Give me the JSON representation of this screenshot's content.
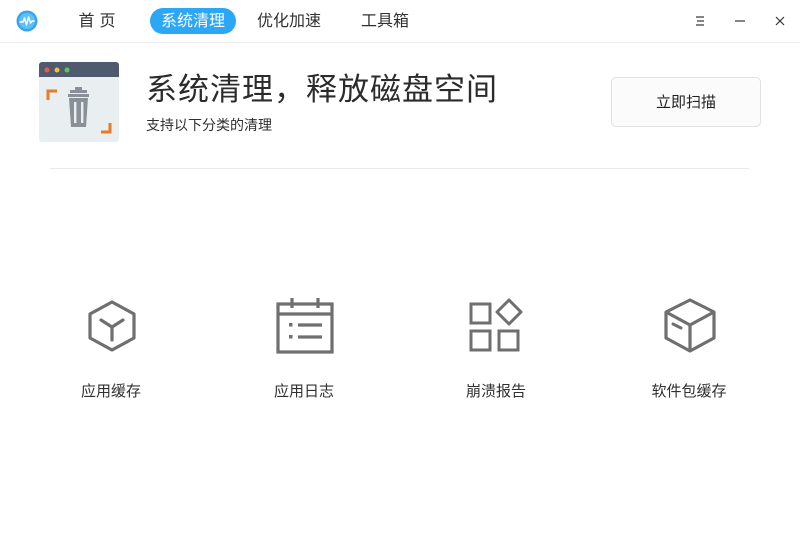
{
  "titlebar": {
    "tabs": [
      {
        "label": "首 页",
        "active": false
      },
      {
        "label": "系统清理",
        "active": true
      },
      {
        "label": "优化加速",
        "active": false
      },
      {
        "label": "工具箱",
        "active": false
      }
    ],
    "accent_color": "#2ca7f8"
  },
  "header": {
    "title": "系统清理，释放磁盘空间",
    "subtitle": "支持以下分类的清理",
    "scan_button": "立即扫描"
  },
  "categories": [
    {
      "label": "应用缓存",
      "icon": "cube-y-icon"
    },
    {
      "label": "应用日志",
      "icon": "calendar-list-icon"
    },
    {
      "label": "崩溃报告",
      "icon": "grid-diamond-icon"
    },
    {
      "label": "软件包缓存",
      "icon": "package-box-icon"
    }
  ]
}
